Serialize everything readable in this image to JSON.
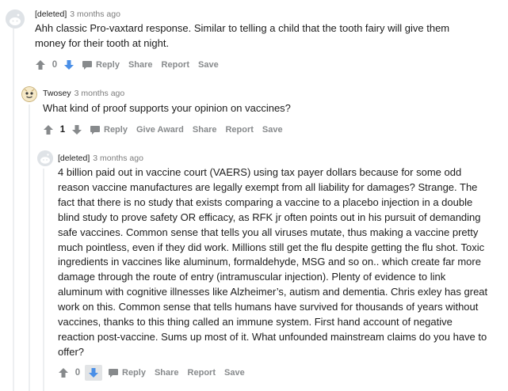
{
  "comments": [
    {
      "author": "[deleted]",
      "time": "3 months ago",
      "text": "Ahh classic Pro-vaxtard response. Similar to telling a child that the tooth fairy will give them money for their tooth at night.",
      "score": "0",
      "actions": [
        "Reply",
        "Share",
        "Report",
        "Save"
      ]
    },
    {
      "author": "Twosey",
      "time": "3 months ago",
      "text": "What kind of proof supports your opinion on vaccines?",
      "score": "1",
      "actions": [
        "Reply",
        "Give Award",
        "Share",
        "Report",
        "Save"
      ]
    },
    {
      "author": "[deleted]",
      "time": "3 months ago",
      "text": "4 billion paid out in vaccine court (VAERS) using tax payer dollars because for some odd reason vaccine manufactures are legally exempt from all liability for damages? Strange. The fact that there is no study that exists comparing a vaccine to a placebo injection in a double blind study to prove safety OR efficacy, as RFK jr often points out in his pursuit of demanding safe vaccines. Common sense that tells you all viruses mutate, thus making a vaccine pretty much pointless, even if they did work. Millions still get the flu despite getting the flu shot. Toxic ingredients in vaccines like aluminum, formaldehyde, MSG and so on.. which create far more damage through the route of entry (intramuscular injection). Plenty of evidence to link aluminum with cognitive illnesses like Alzheimer’s, autism and dementia. Chris exley has great work on this. Common sense that tells humans have survived for thousands of years without vaccines, thanks to this thing called an immune system. First hand account of negative reaction post-vaccine. Sums up most of it. What unfounded mainstream claims do you have to offer?",
      "score": "0",
      "actions": [
        "Reply",
        "Share",
        "Report",
        "Save"
      ]
    }
  ],
  "colors": {
    "upvote": "#878a8c",
    "downvote_blue": "#4a8fe7",
    "text": "#1c1c1c",
    "meta": "#7c7c7c",
    "thread_line": "#edeff1"
  }
}
